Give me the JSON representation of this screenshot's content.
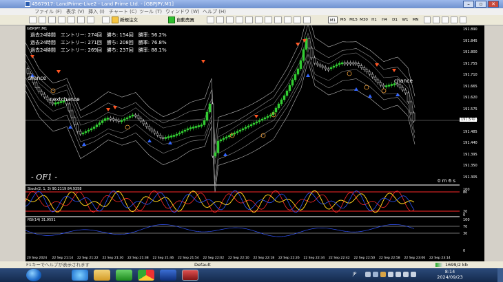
{
  "titlebar": {
    "title": "4567917: LandPrime-Live2 - Land Prime Ltd. - [GBPJPY,M1]",
    "minimize": "–",
    "restore": "▫",
    "close": "✕"
  },
  "menu": {
    "file": "ファイル (F)",
    "view": "表示 (V)",
    "insert": "挿入 (I)",
    "chart": "チャート (C)",
    "tools": "ツール (T)",
    "window": "ウィンドウ (W)",
    "help": "ヘルプ (H)"
  },
  "toolbar": {
    "new_order": "新規注文",
    "auto_trading": "自動売買",
    "timeframes": [
      "M1",
      "M5",
      "M15",
      "M30",
      "H1",
      "H4",
      "D1",
      "W1",
      "MN"
    ],
    "active_timeframe": "M1"
  },
  "chart": {
    "symbol_label": "GBPJPY,M1",
    "info_lines": [
      "過去24時間　エントリー: 274回　勝ち: 154回　勝率: 56.2%",
      "過去24時間　エントリー: 271回　勝ち: 208回　勝率: 76.8%",
      "過去24時間　エントリー: 269回　勝ち: 237回　勝率: 88.1%"
    ],
    "annotations": {
      "chance_left": "chance",
      "nextchance": "nextchance",
      "chance_right": "chance"
    },
    "watermark": "- OF1 -",
    "countdown": "0 m 6 s",
    "stoch_label": "Stoch(2, 1, 3) 90.2119 84.9358",
    "rsi_label": "RSI(14) 31.9551",
    "current_price": "191.549",
    "price_ticks": [
      "191.890",
      "191.845",
      "191.800",
      "191.755",
      "191.710",
      "191.665",
      "191.620",
      "191.575",
      "191.530",
      "191.485",
      "191.440",
      "191.395",
      "191.350",
      "191.305"
    ],
    "stoch_ticks": [
      "100",
      "80",
      "20",
      "0"
    ],
    "rsi_ticks": [
      "100",
      "70",
      "30",
      "0"
    ],
    "time_ticks": [
      "20 Sep 2024",
      "22 Sep 21:14",
      "22 Sep 21:22",
      "22 Sep 21:30",
      "22 Sep 21:38",
      "22 Sep 21:46",
      "22 Sep 21:54",
      "22 Sep 22:02",
      "22 Sep 22:10",
      "22 Sep 22:18",
      "22 Sep 22:26",
      "22 Sep 22:34",
      "22 Sep 22:42",
      "22 Sep 22:50",
      "22 Sep 22:58",
      "22 Sep 23:06",
      "22 Sep 23:14"
    ]
  },
  "status": {
    "help_hint": "F1キーでヘルプが表示されます",
    "profile": "Default",
    "traffic": "1699/2 kb"
  },
  "taskbar": {
    "time": "8:14",
    "date": "2024/09/23",
    "lang": "JP"
  },
  "colors": {
    "bull": "#33cc33",
    "bear": "#e8e8e8",
    "up_arrow": "#3366ff",
    "down_arrow": "#ff5522",
    "stoch_red": "#ff2a2a",
    "stoch_yellow": "#ffd21a",
    "stoch_blue": "#2a55ff",
    "rsi": "#3355ff"
  }
}
